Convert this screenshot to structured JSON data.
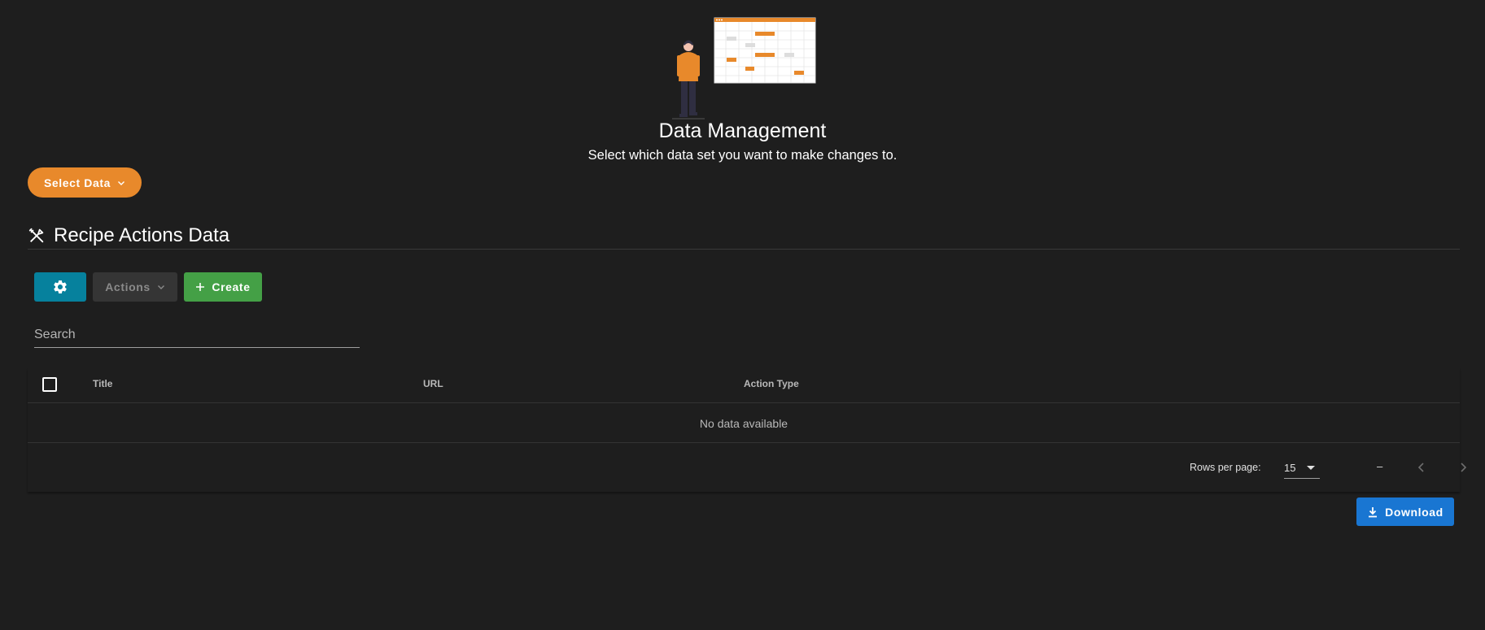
{
  "hero": {
    "title": "Data Management",
    "subtitle": "Select which data set you want to make changes to."
  },
  "select_data": {
    "label": "Select Data",
    "icon": "chevron-down-icon"
  },
  "section": {
    "title": "Recipe Actions Data",
    "icon": "silverware-icon"
  },
  "toolbar": {
    "settings_icon": "gear-icon",
    "actions_label": "Actions",
    "create_label": "Create"
  },
  "search": {
    "placeholder": "Search",
    "value": ""
  },
  "table": {
    "columns": [
      "Title",
      "URL",
      "Action Type"
    ],
    "empty_text": "No data available",
    "footer": {
      "rows_per_page_label": "Rows per page:",
      "rows_per_page_value": "15",
      "range_text": "–"
    }
  },
  "download": {
    "label": "Download"
  },
  "colors": {
    "background": "#1e1e1e",
    "accent_orange": "#e8892b",
    "settings_teal": "#06819d",
    "create_green": "#44a046",
    "download_blue": "#1976d2"
  }
}
